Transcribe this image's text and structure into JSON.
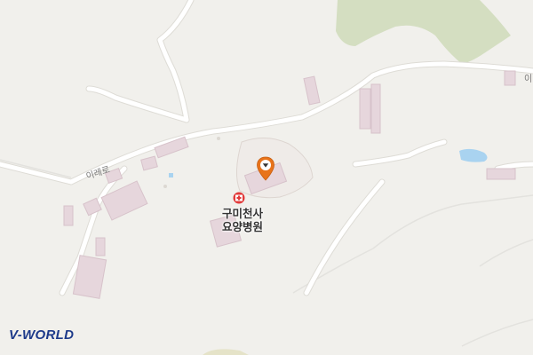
{
  "map": {
    "road_labels": [
      {
        "text": "이레로"
      },
      {
        "text": "이"
      }
    ],
    "poi": {
      "name_line1": "구미천사",
      "name_line2": "요양병원",
      "icon": "hospital-icon"
    },
    "marker": {
      "icon": "location-pin-icon"
    },
    "branding": {
      "logo_text": "V-WORLD"
    },
    "colors": {
      "background": "#f1f0ec",
      "green_area": "#d4dec1",
      "building": "#e6d6dc",
      "building_stroke": "#d7c2ca",
      "road": "#ffffff",
      "water": "#a9d3f0",
      "marker": "#e8731a",
      "hospital": "#e23a3a"
    }
  }
}
